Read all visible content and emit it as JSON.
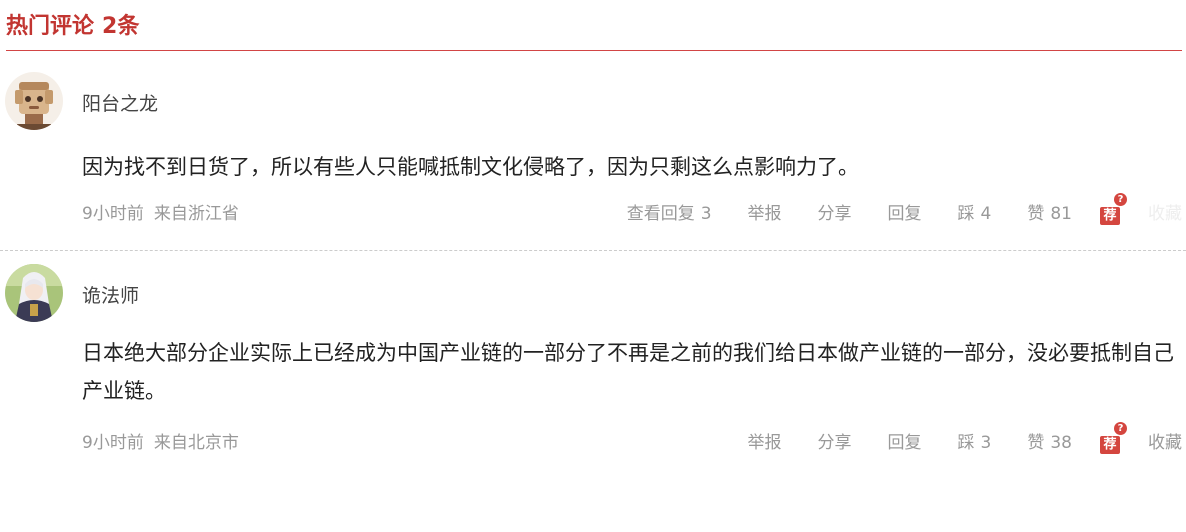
{
  "header": {
    "title": "热门评论",
    "count": "2条"
  },
  "comments": [
    {
      "username": "阳台之龙",
      "content": "因为找不到日货了，所以有些人只能喊抵制文化侵略了，因为只剩这么点影响力了。",
      "time": "9小时前",
      "location": "来自浙江省",
      "view_replies": "查看回复",
      "reply_count": "3",
      "report": "举报",
      "share": "分享",
      "reply": "回复",
      "dislike": "踩",
      "dislike_count": "4",
      "like": "赞",
      "like_count": "81",
      "recommend": "荐",
      "badge": "?",
      "favorite": "收藏"
    },
    {
      "username": "诡法师",
      "content": "日本绝大部分企业实际上已经成为中国产业链的一部分了不再是之前的我们给日本做产业链的一部分，没必要抵制自己产业链。",
      "time": "9小时前",
      "location": "来自北京市",
      "report": "举报",
      "share": "分享",
      "reply": "回复",
      "dislike": "踩",
      "dislike_count": "3",
      "like": "赞",
      "like_count": "38",
      "recommend": "荐",
      "badge": "?",
      "favorite": "收藏"
    }
  ],
  "colors": {
    "accent": "#c23531",
    "meta": "#999999"
  }
}
